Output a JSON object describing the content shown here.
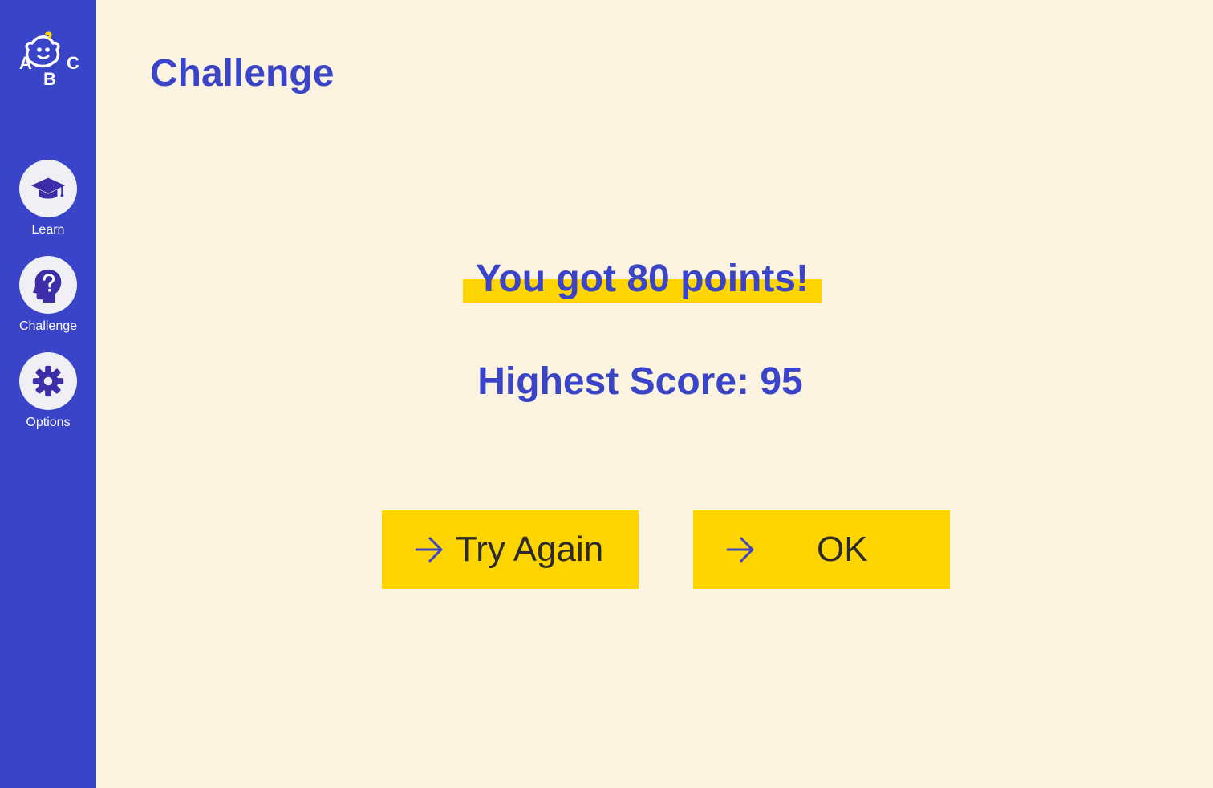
{
  "colors": {
    "sidebar": "#3944C8",
    "background": "#FCF4E0",
    "accent": "#FFD500",
    "title_text": "#3944C8",
    "button_text": "#2B2B2B"
  },
  "logo": {
    "letters": [
      "A",
      "B",
      "C"
    ],
    "icon": "baby-face-icon"
  },
  "sidebar": {
    "items": [
      {
        "label": "Learn",
        "icon": "graduation-cap-icon"
      },
      {
        "label": "Challenge",
        "icon": "head-question-icon"
      },
      {
        "label": "Options",
        "icon": "gear-icon"
      }
    ]
  },
  "main": {
    "title": "Challenge",
    "result_text": "You got 80 points!",
    "high_score_text": "Highest Score: 95"
  },
  "buttons": {
    "try_again": {
      "label": "Try Again",
      "icon": "arrow-right-icon"
    },
    "ok": {
      "label": "OK",
      "icon": "arrow-right-icon"
    }
  }
}
